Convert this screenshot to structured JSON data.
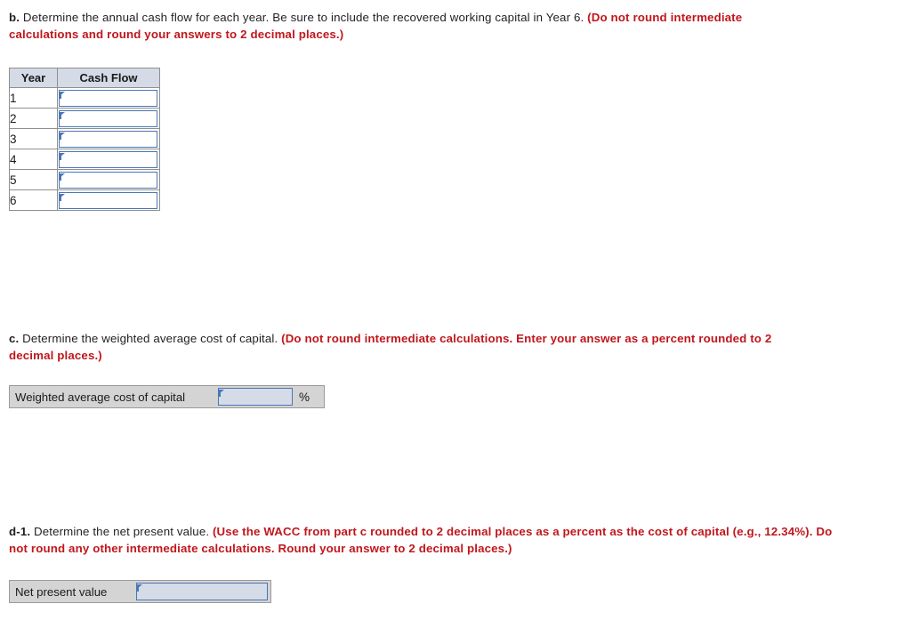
{
  "questions": {
    "b": {
      "label": "b.",
      "plain": " Determine the annual cash flow for each year. Be sure to include the recovered working capital in Year 6. ",
      "red": "(Do not round intermediate calculations and round your answers to 2 decimal places.)"
    },
    "c": {
      "label": "c.",
      "plain": " Determine the weighted average cost of capital. ",
      "red": "(Do not round intermediate calculations. Enter your answer as a percent rounded to 2 decimal places.)"
    },
    "d1": {
      "label": "d-1.",
      "plain": " Determine the net present value. ",
      "red": "(Use the WACC from part c rounded to 2 decimal places as a percent as the cost of capital (e.g., 12.34%). Do not round any other intermediate calculations. Round your answer to 2 decimal places.)"
    }
  },
  "cash_flow_table": {
    "headers": [
      "Year",
      "Cash Flow"
    ],
    "rows": [
      {
        "year": "1",
        "cash_flow": ""
      },
      {
        "year": "2",
        "cash_flow": ""
      },
      {
        "year": "3",
        "cash_flow": ""
      },
      {
        "year": "4",
        "cash_flow": ""
      },
      {
        "year": "5",
        "cash_flow": ""
      },
      {
        "year": "6",
        "cash_flow": ""
      }
    ]
  },
  "wacc_row": {
    "label": "Weighted average cost of capital",
    "value": "",
    "unit": "%"
  },
  "npv_row": {
    "label": "Net present value",
    "value": ""
  },
  "colors": {
    "red_emphasis": "#c0171c",
    "body_text": "#231f20",
    "header_fill": "#d4dae6",
    "input_border": "#4a76b8",
    "input_filled": "#d5dbe7",
    "row_fill": "#d4d4d4"
  }
}
